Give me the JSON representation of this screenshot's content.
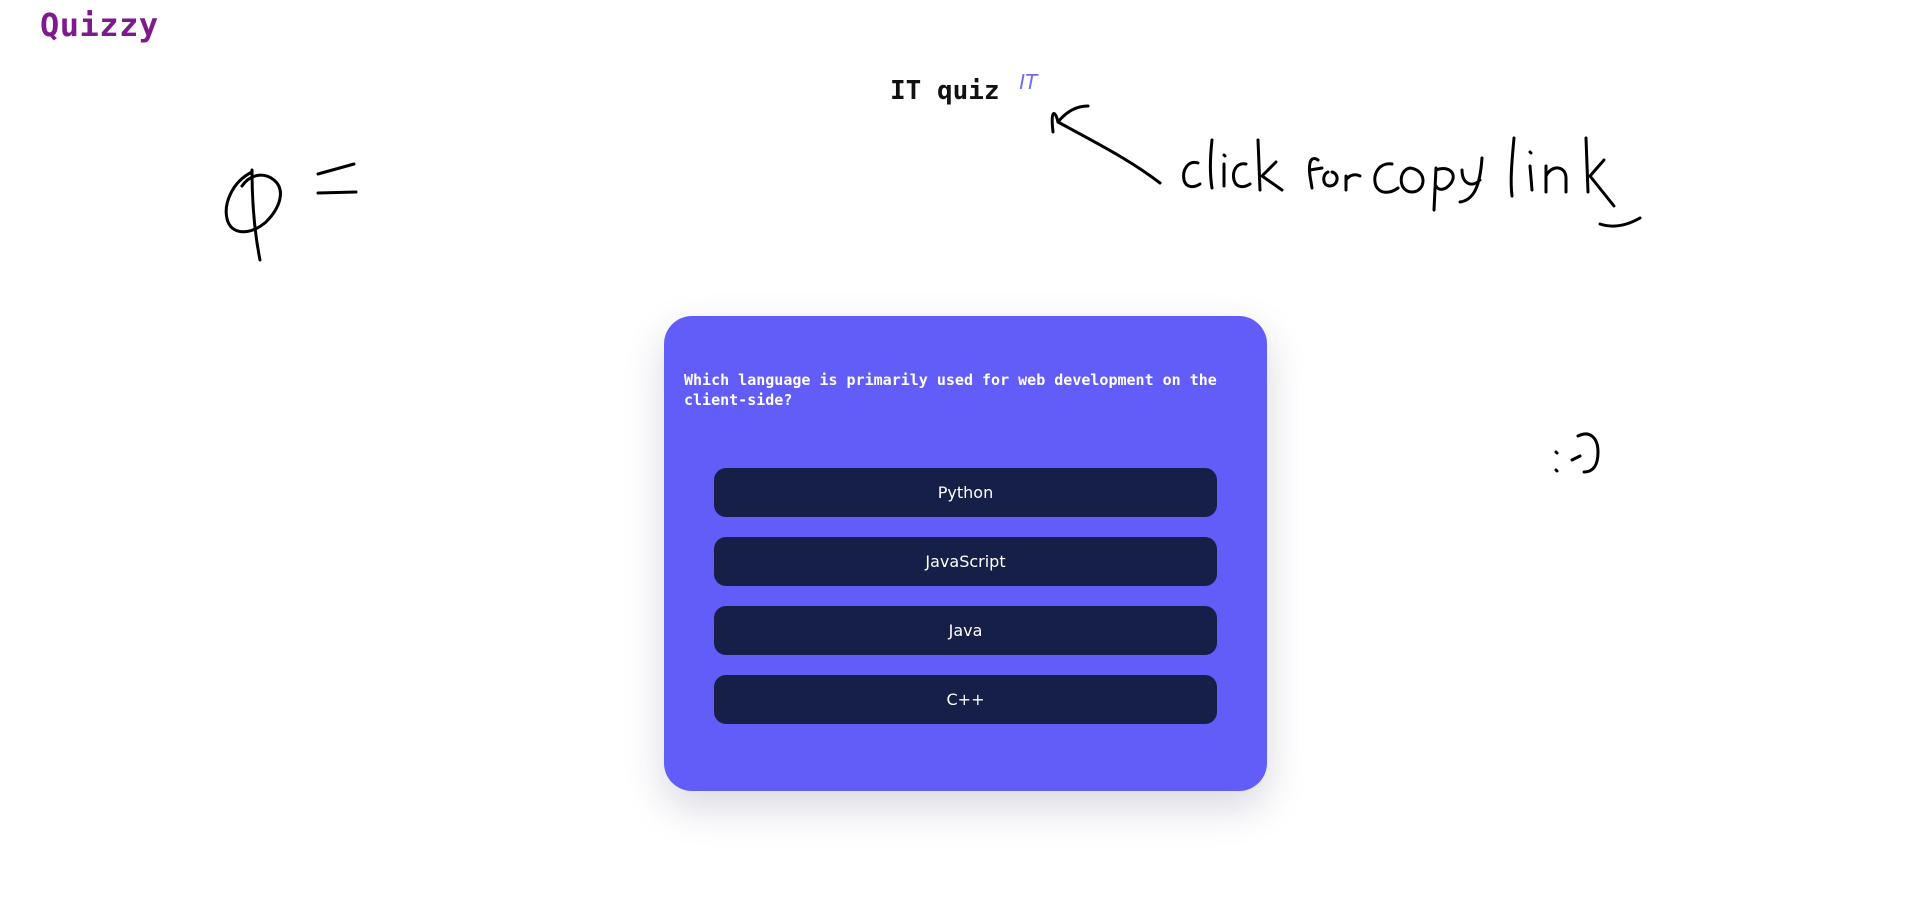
{
  "header": {
    "logo": "Quizzy"
  },
  "quiz": {
    "title": "IT quiz",
    "category_link": "IT"
  },
  "card": {
    "question": "Which language is primarily used for web development on the client-side?",
    "answers": [
      "Python",
      "JavaScript",
      "Java",
      "C++"
    ]
  },
  "colors": {
    "logo": "#7d1a8c",
    "card_background": "#625df9",
    "answer_background": "#161f48",
    "category_link": "#6e6cf0"
  }
}
